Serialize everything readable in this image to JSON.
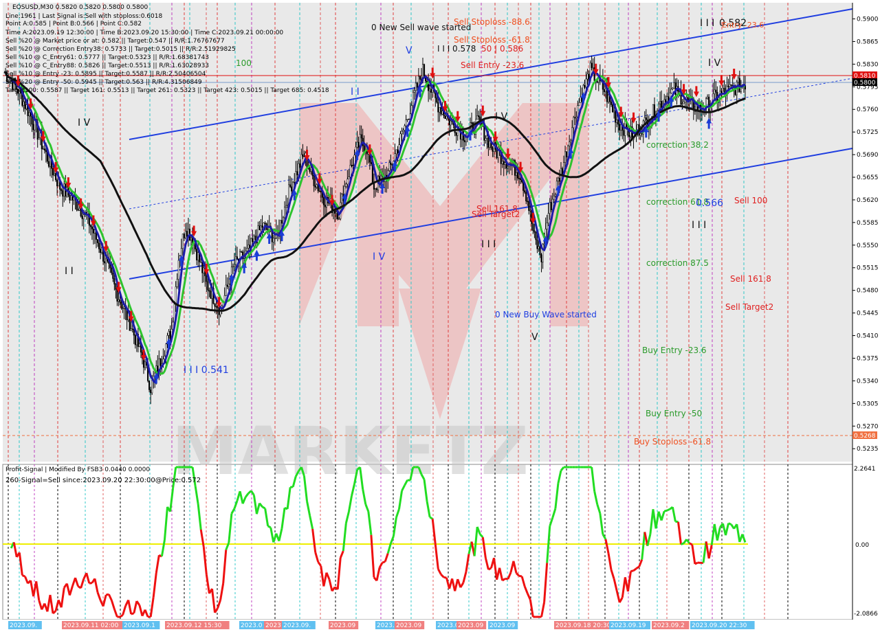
{
  "header": {
    "symbol_line": "EOSUSD,M30  0.5820 0.5820 0.5800 0.5800",
    "info_lines": [
      "Line:1961 | Last Signal is:Sell with stoploss:0.6018",
      "Point A:0.585 | Point B:0.566 | Point C:0.582",
      "Time A:2023.09.19 12:30:00 | Time B:2023.09.20 15:30:00 | Time C:2023.09.21 00:00:00",
      "Sell %20 @ Market price or at: 0.582 || Target:0.547 || R/R:1.76767677",
      "Sell %20 @ Correction Entry38: 0.5733 || Target:0.5015 || R/R:2.51929825",
      "Sell %10 @ C_Entry61: 0.5777 || Target:0.5323 || R/R:1.68381743",
      "Sell %10 @ C_Entry88: 0.5826 || Target:0.5513 || R/R:1.63028933",
      "Sell %10 @ Entry -23: 0.5895 || Target:0.5587 || R/R:2.50406504",
      "Sell %20 @ Entry -50: 0.5945 || Target:0.563 || R/R:4.31506849",
      "Target100: 0.5587 || Target 161: 0.5513 || Target 261: 0.5323 || Target 423: 0.5015 || Target 685: 0.4518"
    ]
  },
  "annotations": {
    "new_sell_wave": "0 New Sell wave started",
    "new_buy_wave": "0 New Buy Wave started",
    "sell_stoploss_88": "Sell Stoploss -88.6",
    "sell_stoploss_61": "Sell Stoploss -61.8",
    "sell_entry_23": "Sell Entry -23.6",
    "sell_entry_50_label": "50 | 0.586",
    "sell_100": "Sell 100",
    "sell_161": "Sell 161.8",
    "sell_target2": "Sell Target2",
    "sell_161_mid": "Sell 161.8",
    "sell_target2_mid": "Sell Target2",
    "correction_382": "correction 38.2",
    "correction_618": "correction 61.8",
    "correction_875": "correction 87.5",
    "buy_entry_23": "Buy Entry -23.6",
    "buy_entry_50": "Buy Entry -50",
    "buy_stoploss_61": "Buy Stoploss -61.8",
    "wave_label_iii_0578": "I I I 0.578",
    "wave_label_iii_0541": "I I I 0.541",
    "wave_label_0566": "0.566",
    "wave_label_0582": "0.582",
    "wave_label_entry_23_top": "Entry -23.6",
    "wave_label_100": "100",
    "roman_v_top": "V",
    "roman_iv_1": "I V",
    "roman_iv_2": "I V",
    "roman_iv_3": "I V",
    "roman_iv_4": "I V",
    "roman_ii_1": "I I",
    "roman_ii_2": "I I",
    "roman_iii_1": "I I I",
    "roman_iii_2": "I I I",
    "roman_iii_3": "I I I",
    "roman_v_bottom": "V",
    "roman_i_top": "I",
    "top_cut_text": "0 New Sell wave started"
  },
  "price_axis": {
    "ticks": [
      "0.5900",
      "0.5865",
      "0.5830",
      "0.5795",
      "0.5760",
      "0.5725",
      "0.5690",
      "0.5655",
      "0.5620",
      "0.5585",
      "0.5550",
      "0.5515",
      "0.5480",
      "0.5445",
      "0.5410",
      "0.5375",
      "0.5340",
      "0.5305",
      "0.5270",
      "0.5235"
    ],
    "current_price": "0.5800",
    "red_level": "0.5810",
    "stoploss_level": "0.5268"
  },
  "time_axis": {
    "labels": [
      "2023.09.",
      "2023.09.11 02:00",
      "2023.09.1",
      "2023.09.12 15:30",
      "2023.0",
      "2023",
      "2023.09.",
      "2023.09",
      "2023.09.",
      "2023.09",
      "2023.09.",
      "2023.09",
      "2023.09",
      "2023.09.18 20:30",
      "2023.09.19",
      "2023.09.2",
      "2023.09.20 22:30"
    ]
  },
  "indicator": {
    "title": "Profit-Signal | Modified By FSB3 0.0440 0.0000",
    "signal_line": "260-Signal=Sell since:2023.09.20 22:30:00@Price:0.572",
    "axis_top": "2.2641",
    "axis_zero": "0.00",
    "axis_bottom": "-2.0866"
  },
  "colors": {
    "up_arrow": "#1a3cd6",
    "down_arrow": "#e01010",
    "ma_green": "#2ec42e",
    "ma_blue": "#1c1ca8",
    "ma_black": "#111111",
    "channel": "#1f3ee0",
    "osc_pos": "#22dd22",
    "osc_neg": "#ee1111",
    "zero_line": "#eeee00",
    "current_price_bg": "#000000",
    "red_level_bg": "#e01010",
    "stoploss_bg": "#f07040"
  },
  "chart_data": {
    "type": "candlestick",
    "symbol": "EOSUSD",
    "timeframe": "M30",
    "ohlc_last": {
      "open": 0.582,
      "high": 0.582,
      "low": 0.58,
      "close": 0.58
    },
    "ylim": [
      0.5215,
      0.5925
    ],
    "close_path": [
      [
        0,
        0.5818
      ],
      [
        10,
        0.579
      ],
      [
        20,
        0.5745
      ],
      [
        30,
        0.569
      ],
      [
        40,
        0.564
      ],
      [
        50,
        0.562
      ],
      [
        60,
        0.559
      ],
      [
        70,
        0.554
      ],
      [
        80,
        0.548
      ],
      [
        90,
        0.543
      ],
      [
        100,
        0.537
      ],
      [
        105,
        0.533
      ],
      [
        110,
        0.536
      ],
      [
        120,
        0.542
      ],
      [
        125,
        0.553
      ],
      [
        130,
        0.558
      ],
      [
        135,
        0.556
      ],
      [
        145,
        0.549
      ],
      [
        155,
        0.545
      ],
      [
        165,
        0.552
      ],
      [
        175,
        0.554
      ],
      [
        185,
        0.558
      ],
      [
        195,
        0.556
      ],
      [
        205,
        0.564
      ],
      [
        215,
        0.569
      ],
      [
        220,
        0.566
      ],
      [
        230,
        0.562
      ],
      [
        240,
        0.56
      ],
      [
        245,
        0.565
      ],
      [
        255,
        0.571
      ],
      [
        260,
        0.57
      ],
      [
        265,
        0.564
      ],
      [
        275,
        0.566
      ],
      [
        285,
        0.572
      ],
      [
        295,
        0.579
      ],
      [
        300,
        0.582
      ],
      [
        310,
        0.577
      ],
      [
        320,
        0.574
      ],
      [
        330,
        0.572
      ],
      [
        340,
        0.574
      ],
      [
        350,
        0.57
      ],
      [
        360,
        0.568
      ],
      [
        370,
        0.566
      ],
      [
        375,
        0.562
      ],
      [
        380,
        0.556
      ],
      [
        385,
        0.553
      ],
      [
        390,
        0.56
      ],
      [
        400,
        0.567
      ],
      [
        410,
        0.576
      ],
      [
        420,
        0.582
      ],
      [
        430,
        0.579
      ],
      [
        440,
        0.574
      ],
      [
        450,
        0.572
      ],
      [
        460,
        0.574
      ],
      [
        470,
        0.577
      ],
      [
        480,
        0.579
      ],
      [
        490,
        0.577
      ],
      [
        500,
        0.576
      ],
      [
        510,
        0.578
      ],
      [
        520,
        0.579
      ],
      [
        530,
        0.58
      ]
    ],
    "levels": [
      {
        "label": "Sell Stoploss -88.6",
        "value": 0.5898
      },
      {
        "label": "Sell Stoploss -61.8",
        "value": 0.5873
      },
      {
        "label": "Sell Entry -23.6",
        "value": 0.5838
      },
      {
        "label": "correction 38.2",
        "value": 0.5703
      },
      {
        "label": "correction 61.8",
        "value": 0.5618
      },
      {
        "label": "correction 87.5",
        "value": 0.5543
      },
      {
        "label": "Buy Entry -23.6",
        "value": 0.5392
      },
      {
        "label": "Buy Entry -50",
        "value": 0.5298
      },
      {
        "label": "Buy Stoploss -61.8",
        "value": 0.5256
      },
      {
        "label": "Sell 100",
        "value": 0.562
      },
      {
        "label": "Sell 161.8",
        "value": 0.5505
      },
      {
        "label": "Sell Target2",
        "value": 0.5462
      }
    ]
  }
}
